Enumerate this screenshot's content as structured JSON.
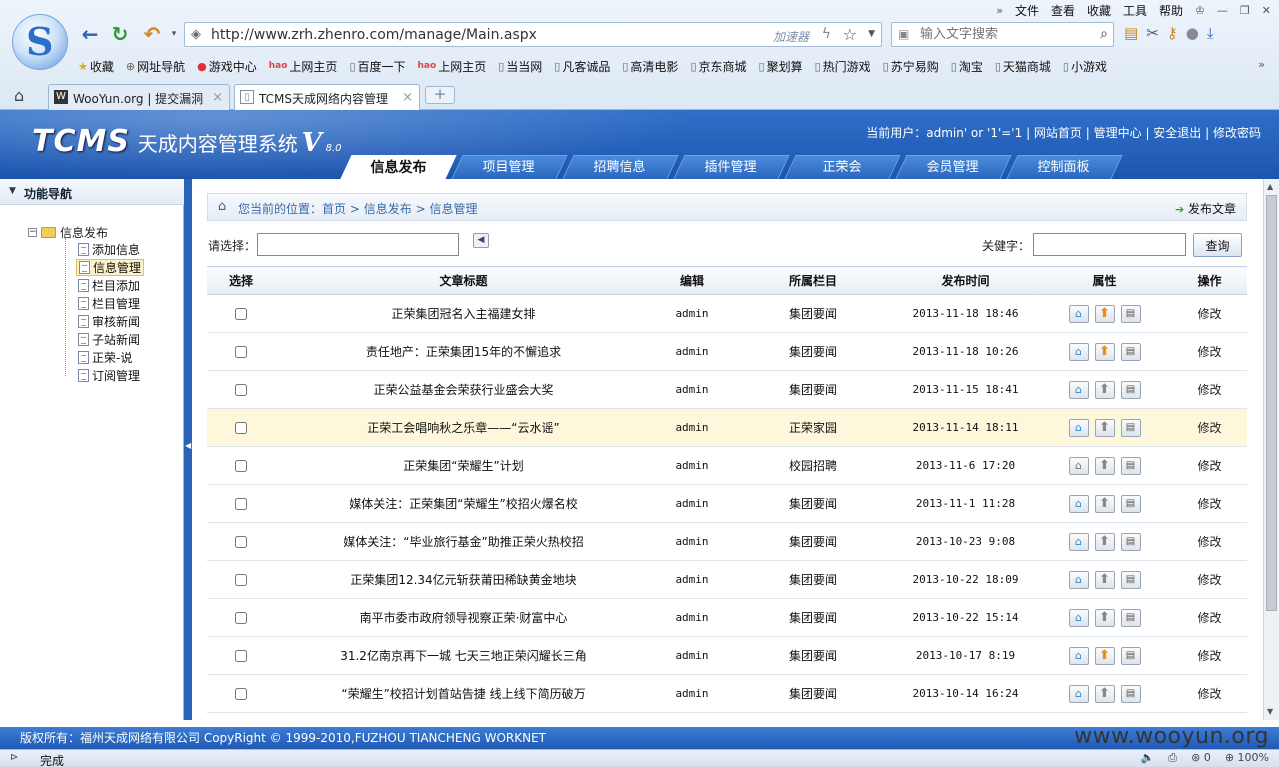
{
  "browser": {
    "menu": [
      "文件",
      "查看",
      "收藏",
      "工具",
      "帮助"
    ],
    "url": "http://www.zrh.zhenro.com/manage/Main.aspx",
    "accelerator": "加速器",
    "search_placeholder": "输入文字搜索",
    "bookmarks": [
      {
        "label": "收藏",
        "icon": "star-icon"
      },
      {
        "label": "网址导航",
        "icon": "globe-icon"
      },
      {
        "label": "游戏中心",
        "icon": "game-icon"
      },
      {
        "label": "上网主页",
        "icon": "hao-icon"
      },
      {
        "label": "百度一下",
        "icon": "page-icon"
      },
      {
        "label": "上网主页",
        "icon": "hao-icon"
      },
      {
        "label": "当当网",
        "icon": "page-icon"
      },
      {
        "label": "凡客诚品",
        "icon": "page-icon"
      },
      {
        "label": "高清电影",
        "icon": "page-icon"
      },
      {
        "label": "京东商城",
        "icon": "page-icon"
      },
      {
        "label": "聚划算",
        "icon": "page-icon"
      },
      {
        "label": "热门游戏",
        "icon": "page-icon"
      },
      {
        "label": "苏宁易购",
        "icon": "page-icon"
      },
      {
        "label": "淘宝",
        "icon": "page-icon"
      },
      {
        "label": "天猫商城",
        "icon": "page-icon"
      },
      {
        "label": "小游戏",
        "icon": "page-icon"
      }
    ],
    "tabs": [
      {
        "label": "WooYun.org | 提交漏洞",
        "active": false
      },
      {
        "label": "TCMS天成网络内容管理",
        "active": true
      }
    ]
  },
  "app": {
    "brand_tcms": "TCMS",
    "brand_name": "天成内容管理系统",
    "brand_v": "V",
    "brand_version": "8.0",
    "user_label": "当前用户：",
    "user_name": "admin' or '1'='1",
    "links": [
      "网站首页",
      "管理中心",
      "安全退出",
      "修改密码"
    ],
    "nav_tabs": [
      {
        "label": "信息发布",
        "active": true
      },
      {
        "label": "项目管理",
        "active": false
      },
      {
        "label": "招聘信息",
        "active": false
      },
      {
        "label": "插件管理",
        "active": false
      },
      {
        "label": "正荣会",
        "active": false
      },
      {
        "label": "会员管理",
        "active": false
      },
      {
        "label": "控制面板",
        "active": false
      }
    ]
  },
  "sidebar": {
    "title": "功能导航",
    "root": "信息发布",
    "items": [
      {
        "label": "添加信息",
        "selected": false
      },
      {
        "label": "信息管理",
        "selected": true
      },
      {
        "label": "栏目添加",
        "selected": false
      },
      {
        "label": "栏目管理",
        "selected": false
      },
      {
        "label": "审核新闻",
        "selected": false
      },
      {
        "label": "子站新闻",
        "selected": false
      },
      {
        "label": "正荣-说",
        "selected": false
      },
      {
        "label": "订阅管理",
        "selected": false
      }
    ]
  },
  "main": {
    "crumb_prefix": "您当前的位置：",
    "crumb": [
      "首页",
      "信息发布",
      "信息管理"
    ],
    "publish": "发布文章",
    "filter_label": "请选择：",
    "keyword_label": "关健字：",
    "query_button": "查询",
    "columns": [
      "选择",
      "文章标题",
      "编辑",
      "所属栏目",
      "发布时间",
      "属性",
      "操作"
    ],
    "edit_label": "修改",
    "rows": [
      {
        "title": "正荣集团冠名入主福建女排",
        "editor": "admin",
        "column": "集团要闻",
        "time": "2013-11-18 18:46",
        "home": true,
        "up": true,
        "hl": false
      },
      {
        "title": "责任地产：正荣集团15年的不懈追求",
        "editor": "admin",
        "column": "集团要闻",
        "time": "2013-11-18 10:26",
        "home": true,
        "up": true,
        "hl": false
      },
      {
        "title": "正荣公益基金会荣获行业盛会大奖",
        "editor": "admin",
        "column": "集团要闻",
        "time": "2013-11-15 18:41",
        "home": true,
        "up": false,
        "hl": false
      },
      {
        "title": "正荣工会唱响秋之乐章——“云水谣”",
        "editor": "admin",
        "column": "正荣家园",
        "time": "2013-11-14 18:11",
        "home": true,
        "up": false,
        "hl": true
      },
      {
        "title": "正荣集团“荣耀生”计划",
        "editor": "admin",
        "column": "校园招聘",
        "time": "2013-11-6 17:20",
        "home": false,
        "up": false,
        "hl": false
      },
      {
        "title": "媒体关注：正荣集团“荣耀生”校招火爆名校",
        "editor": "admin",
        "column": "集团要闻",
        "time": "2013-11-1 11:28",
        "home": true,
        "up": false,
        "hl": false
      },
      {
        "title": "媒体关注：“毕业旅行基金”助推正荣火热校招",
        "editor": "admin",
        "column": "集团要闻",
        "time": "2013-10-23 9:08",
        "home": true,
        "up": false,
        "hl": false
      },
      {
        "title": "正荣集团12.34亿元斩获莆田稀缺黄金地块",
        "editor": "admin",
        "column": "集团要闻",
        "time": "2013-10-22 18:09",
        "home": true,
        "up": false,
        "hl": false
      },
      {
        "title": "南平市委市政府领导视察正荣·财富中心",
        "editor": "admin",
        "column": "集团要闻",
        "time": "2013-10-22 15:14",
        "home": true,
        "up": false,
        "hl": false
      },
      {
        "title": "31.2亿南京再下一城 七天三地正荣闪耀长三角",
        "editor": "admin",
        "column": "集团要闻",
        "time": "2013-10-17 8:19",
        "home": true,
        "up": true,
        "hl": false
      },
      {
        "title": "“荣耀生”校招计划首站告捷 线上线下简历破万",
        "editor": "admin",
        "column": "集团要闻",
        "time": "2013-10-14 16:24",
        "home": true,
        "up": false,
        "hl": false
      }
    ]
  },
  "footer": {
    "text": "版权所有：福州天成网络有限公司 CopyRight © 1999-2010,FUZHOU TIANCHENG WORKNET",
    "watermark": "www.wooyun.org"
  },
  "status": {
    "text": "完成",
    "zero": "0",
    "zoom": "100%"
  },
  "colors": {
    "header_blue": "#1d55ae",
    "highlight_row": "#fdf8dc",
    "up_active": "#f08a12"
  }
}
